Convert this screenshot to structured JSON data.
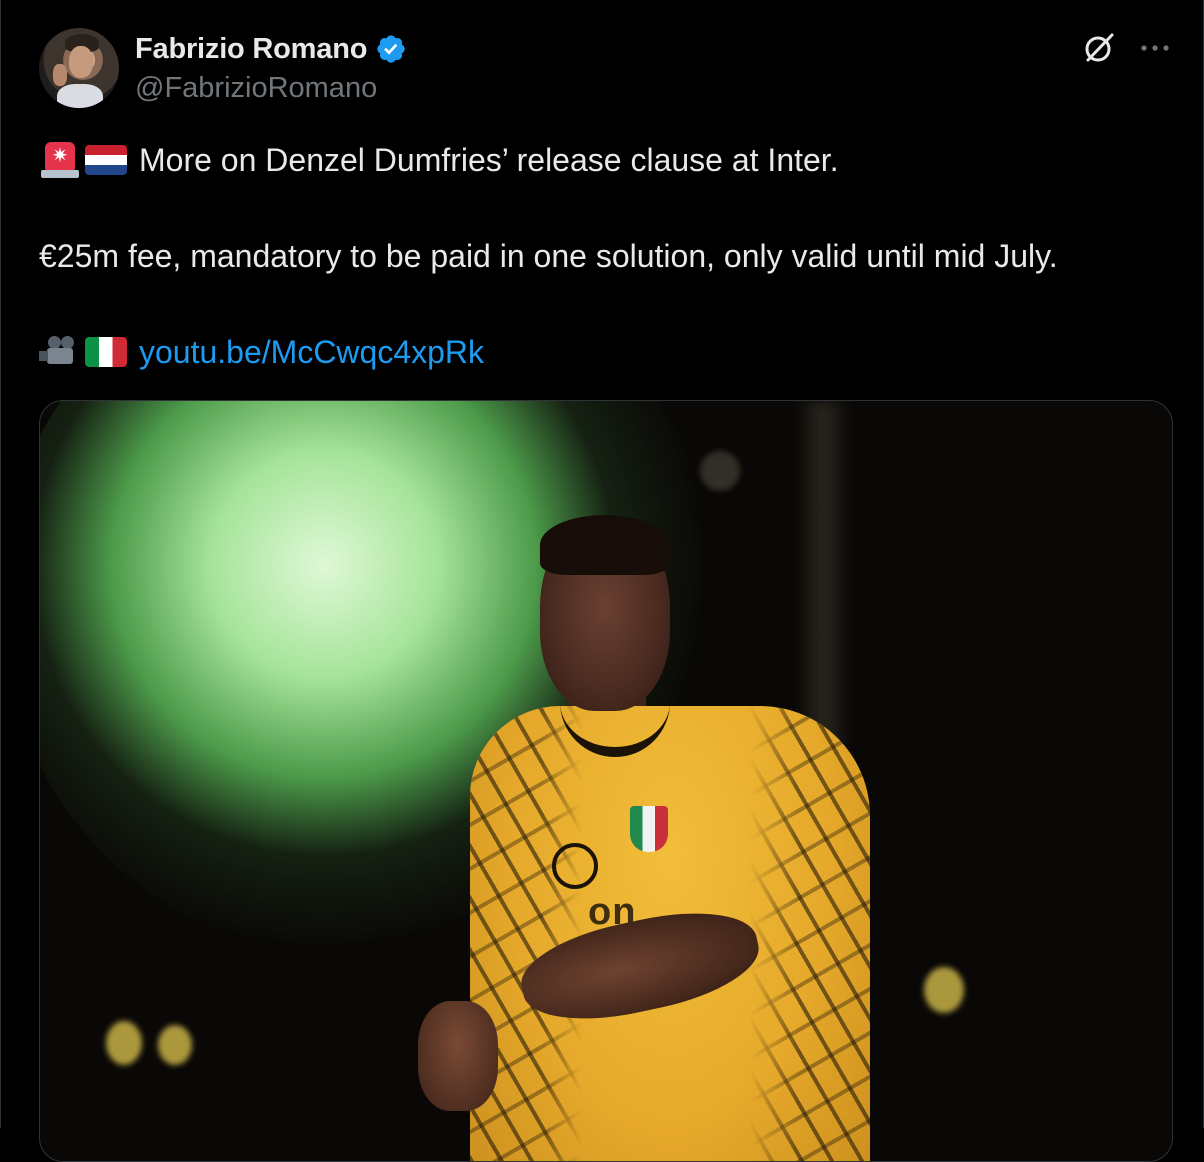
{
  "author": {
    "display_name": "Fabrizio Romano",
    "handle": "@FabrizioRomano",
    "verified_icon": "verified-badge-icon"
  },
  "header_actions": {
    "grok_icon": "grok-icon",
    "more_icon": "more-options-icon",
    "more_glyph": "···"
  },
  "tweet": {
    "line1_emoji": [
      "police-siren-emoji",
      "netherlands-flag-emoji"
    ],
    "line1_text": "More on Denzel Dumfries’ release clause at Inter.",
    "line2_text": "€25m fee, mandatory to be paid in one solution, only valid until mid July.",
    "line3_emoji": [
      "movie-camera-emoji",
      "italy-flag-emoji"
    ],
    "link_text": "youtu.be/McCwqc4xpRk",
    "siren_glyph": "✷"
  },
  "media": {
    "description_icon": "photo-image",
    "jersey_text": "on"
  },
  "colors": {
    "background": "#000000",
    "text_primary": "#e7e9ea",
    "text_secondary": "#71767b",
    "link": "#1d9bf0",
    "verified": "#1d9bf0",
    "border": "#2f3336"
  }
}
